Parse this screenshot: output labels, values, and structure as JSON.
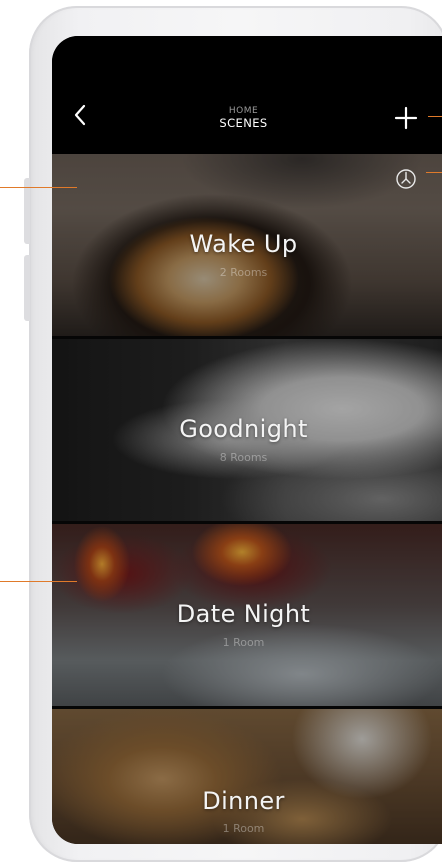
{
  "header": {
    "back_icon": "chevron-left-icon",
    "title_small": "HOME",
    "title_main": "SCENES",
    "add_icon": "plus-icon",
    "history_icon": "clock-icon"
  },
  "scenes": [
    {
      "name": "Wake Up",
      "rooms": "2 Rooms"
    },
    {
      "name": "Goodnight",
      "rooms": "8 Rooms"
    },
    {
      "name": "Date Night",
      "rooms": "1 Room"
    },
    {
      "name": "Dinner",
      "rooms": "1 Room"
    }
  ],
  "colors": {
    "callout": "#e07a2a",
    "header_bg": "#000000",
    "text_primary": "#ffffff"
  }
}
